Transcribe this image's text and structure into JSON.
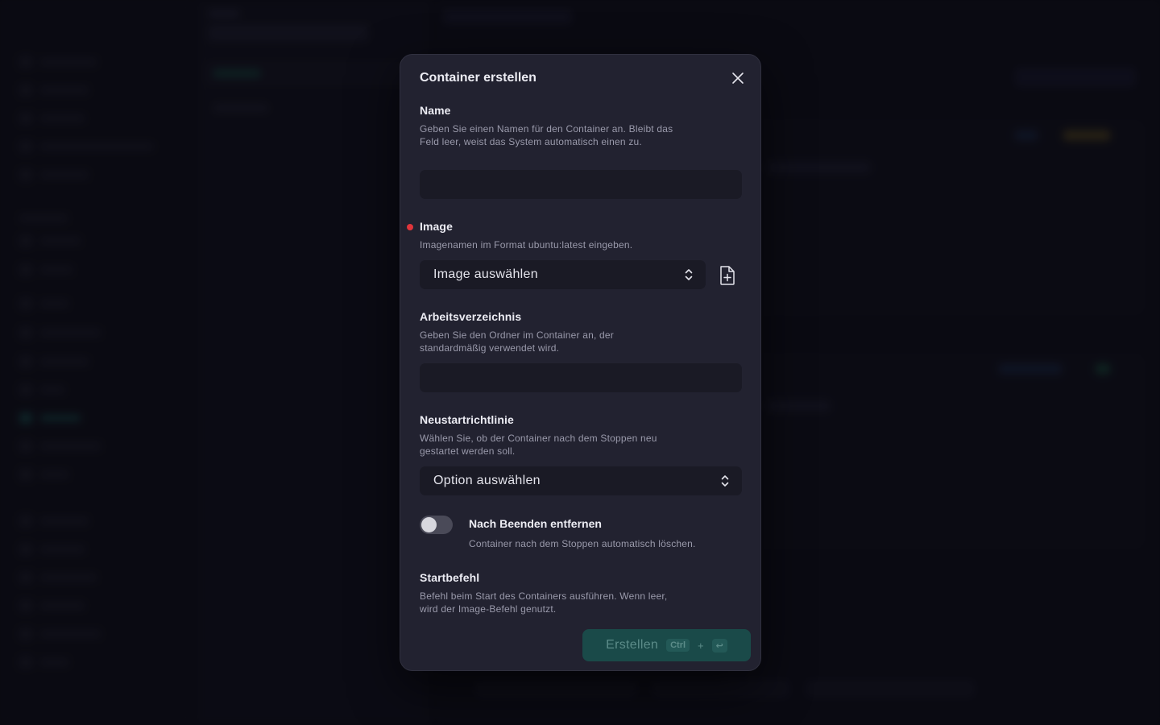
{
  "modal": {
    "title": "Container erstellen",
    "fields": {
      "name": {
        "label": "Name",
        "help": "Geben Sie einen Namen für den Container an. Bleibt das Feld leer, weist das System automatisch einen zu.",
        "value": ""
      },
      "image": {
        "label": "Image",
        "help": "Imagenamen im Format ubuntu:latest eingeben.",
        "selected": "Image auswählen",
        "required": true
      },
      "workdir": {
        "label": "Arbeitsverzeichnis",
        "help": "Geben Sie den Ordner im Container an, der standardmäßig verwendet wird.",
        "value": ""
      },
      "restart_policy": {
        "label": "Neustartrichtlinie",
        "help": "Wählen Sie, ob der Container nach dem Stoppen neu gestartet werden soll.",
        "selected": "Option auswählen"
      },
      "remove_on_exit": {
        "label": "Nach Beenden entfernen",
        "help": "Container nach dem Stoppen automatisch löschen.",
        "enabled": false
      },
      "command": {
        "label": "Startbefehl",
        "help": "Befehl beim Start des Containers ausführen. Wenn leer, wird der Image-Befehl genutzt."
      }
    },
    "submit": {
      "label": "Erstellen",
      "shortcut_mod": "Ctrl",
      "shortcut_plus": "+",
      "shortcut_key": "↩"
    }
  },
  "icons": {
    "close": "close-icon",
    "chevrons": "chevron-up-down-icon",
    "file_add": "file-plus-icon"
  },
  "colors": {
    "modal_bg": "#222230",
    "input_bg": "#1a1a25",
    "required_dot": "#e0353b",
    "primary_button": "#1a4a49"
  }
}
